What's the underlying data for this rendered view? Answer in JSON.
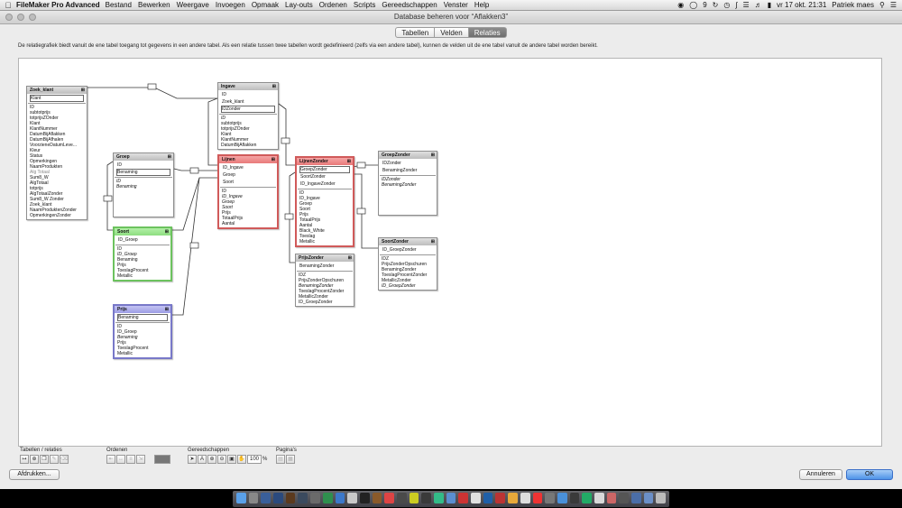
{
  "menubar": {
    "apple": "",
    "app_name": "FileMaker Pro Advanced",
    "items": [
      "Bestand",
      "Bewerken",
      "Weergave",
      "Invoegen",
      "Opmaak",
      "Lay-outs",
      "Ordenen",
      "Scripts",
      "Gereedschappen",
      "Venster",
      "Help"
    ],
    "status": {
      "badge_count": "9",
      "datetime": "vr 17 okt.  21:31",
      "user": "Patriek maes"
    }
  },
  "window": {
    "title": "Database beheren voor “Aflakken3”",
    "tabs": [
      "Tabellen",
      "Velden",
      "Relaties"
    ],
    "active_tab": "Relaties",
    "description": "De relatiegrafiek biedt vanuit de ene tabel toegang tot gegevens in een andere tabel. Als een relatie tussen twee tabellen wordt gedefinieerd (zelfs via een andere tabel), kunnen de velden uit de ene tabel vanuit de andere tabel worden bereikt."
  },
  "tables": {
    "zoek_klant": {
      "name": "Zoek_klant",
      "keys": [
        "Klant"
      ],
      "fields": [
        "ID",
        "subtotprijs",
        "totprijsZOnder",
        "Klant",
        "KlantNummer",
        "DatumBijAflakken",
        "DatumBijAfhalen",
        "VoorzieneDatumLeve...",
        "Kleur",
        "Status",
        "Opmerkingen",
        "NaamProdukten",
        "Alg Totaal",
        "Sum8_W",
        "AlgTotaal",
        "totprijs",
        "AlgTotaalZonder",
        "Sum8_W Zonder",
        "Zoek_klant",
        "NaamProduktenZonder",
        "OpmerkingenZonder"
      ]
    },
    "ingave": {
      "name": "Ingave",
      "keys": [
        "ID",
        "Zoek_klant",
        "IDZonder"
      ],
      "fields": [
        "ID",
        "subtotprijs",
        "totprijsZOnder",
        "Klant",
        "KlantNummer",
        "DatumBijAflakken"
      ]
    },
    "groep": {
      "name": "Groep",
      "keys": [
        "ID",
        "Benaming"
      ],
      "fields": [
        "ID",
        "Benaming"
      ]
    },
    "lijnen": {
      "name": "Lijnen",
      "keys": [
        "ID_Ingave",
        "Groep",
        "Soort"
      ],
      "fields": [
        "ID",
        "ID_Ingave",
        "Groep",
        "Soort",
        "Prijs",
        "TotaalPrijs",
        "Aantal"
      ]
    },
    "lijnenzonder": {
      "name": "LijnenZonder",
      "keys": [
        "GroepZonder",
        "SoortZonder",
        "ID_IngaveZonder"
      ],
      "fields": [
        "ID",
        "ID_Ingave",
        "Groep",
        "Soort",
        "Prijs",
        "TotaalPrijs",
        "Aantal",
        "Black_White",
        "Toeslag",
        "Metallic"
      ]
    },
    "groepzonder": {
      "name": "GroepZonder",
      "keys": [
        "IDZonder",
        "BenamingZonder"
      ],
      "fields": [
        "IDZonder",
        "BenamingZonder"
      ]
    },
    "soort": {
      "name": "Soort",
      "keys": [
        "ID_Groep"
      ],
      "fields": [
        "ID",
        "ID_Groep",
        "Benaming",
        "Prijs",
        "ToeslagProcent",
        "Metallic"
      ]
    },
    "prijszonder": {
      "name": "PrijsZonder",
      "keys": [
        "BenamingZonder"
      ],
      "fields": [
        "IDZ",
        "PrijsZonderOpschuren",
        "BenamingZonder",
        "ToeslagProcentZonder",
        "MetallicZonder",
        "ID_GroepZonder"
      ]
    },
    "soortzonder": {
      "name": "SoortZonder",
      "keys": [
        "ID_GroepZonder"
      ],
      "fields": [
        "IDZ",
        "PrijsZonderOpschuren",
        "BenamingZonder",
        "ToeslagProcentZonder",
        "MetallicZonder",
        "ID_GroepZonder"
      ]
    },
    "prijs": {
      "name": "Prijs",
      "keys": [
        "Benaming"
      ],
      "fields": [
        "ID",
        "ID_Groep",
        "Benaming",
        "Prijs",
        "ToeslagProcent",
        "Metallic"
      ]
    }
  },
  "toolbar": {
    "tables_label": "Tabellen / relaties",
    "arrange_label": "Ordenen",
    "tools_label": "Gereedschappen",
    "pages_label": "Pagina's",
    "zoom_value": "100",
    "zoom_unit": "%"
  },
  "buttons": {
    "print": "Afdrukken...",
    "cancel": "Annuleren",
    "ok": "OK"
  }
}
